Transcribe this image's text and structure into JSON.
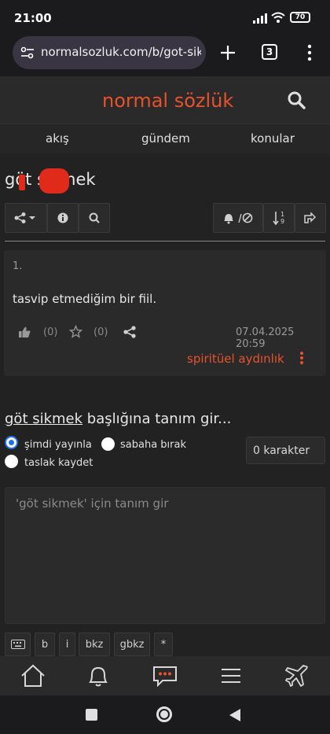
{
  "status": {
    "time": "21:00",
    "battery": "70"
  },
  "browser": {
    "url": "normalsozluk.com/b/got-sikm",
    "tab_count": "3"
  },
  "site": {
    "logo": "normal sözlük"
  },
  "nav": {
    "items": [
      "akış",
      "gündem",
      "konular"
    ]
  },
  "topic": {
    "title": "göt sıkmek",
    "sort_label": "1 9"
  },
  "entry": {
    "number": "1.",
    "text": "tasvip etmediğim bir fiil.",
    "likes": "(0)",
    "favs": "(0)",
    "date": "07.04.2025 20:59",
    "author": "spiritüel aydınlık"
  },
  "compose": {
    "topic_link": "göt sikmek",
    "heading_suffix": " başlığına tanım gir...",
    "radio_now": "şimdi yayınla",
    "radio_morning": "sabaha bırak",
    "radio_draft": "taslak kaydet",
    "char_count": "0 karakter",
    "placeholder": "'göt sikmek' için tanım gir",
    "buttons": {
      "b": "b",
      "i": "i",
      "bkz": "bkz",
      "gbkz": "gbkz",
      "star": "*"
    }
  },
  "colors": {
    "accent": "#e8522a",
    "bg": "#222222",
    "radio_selected": "#1a73e8"
  }
}
